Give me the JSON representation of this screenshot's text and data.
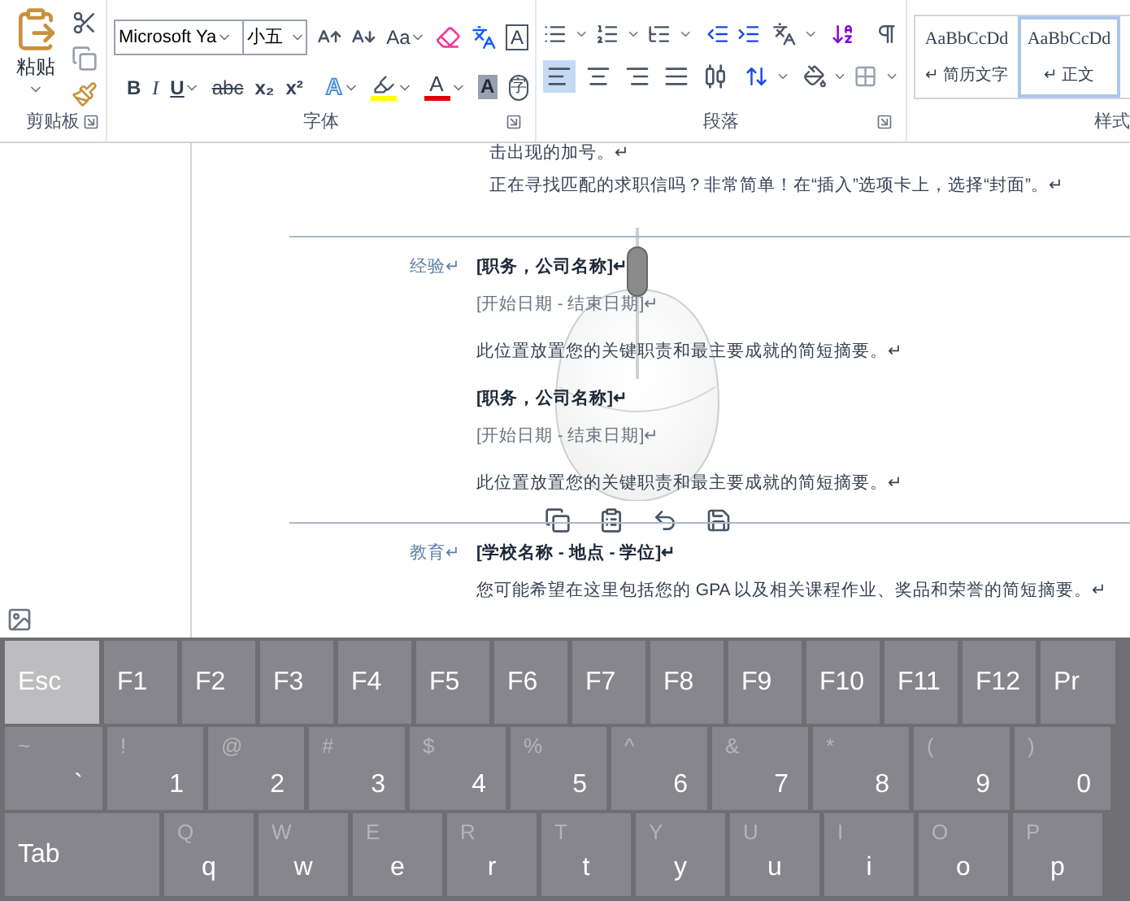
{
  "ribbon": {
    "clipboard": {
      "paste_label": "粘贴",
      "group_label": "剪贴板"
    },
    "font": {
      "font_name": "Microsoft Ya",
      "font_size": "小五",
      "change_case": "Aa",
      "boxed_char": "A",
      "group_label": "字体",
      "format_buttons": [
        "B",
        "I",
        "U",
        "abc",
        "x₂",
        "x²"
      ],
      "color_buttons": [
        {
          "kind": "effects",
          "label": "A"
        },
        {
          "kind": "highlight",
          "color": "#ffff00"
        },
        {
          "kind": "font_color",
          "label": "A",
          "color": "#e00000"
        },
        {
          "kind": "shading",
          "label": "A"
        },
        {
          "kind": "enclose",
          "label": "字"
        }
      ]
    },
    "paragraph": {
      "group_label": "段落",
      "alignments": [
        {
          "selected": true
        },
        {
          "selected": false
        },
        {
          "selected": false
        },
        {
          "selected": false
        },
        {
          "selected": false
        }
      ]
    },
    "styles": {
      "group_label": "样式",
      "items": [
        {
          "preview": "AaBbCcDd",
          "name": "↵ 简历文字",
          "selected": false
        },
        {
          "preview": "AaBbCcDd",
          "name": "↵ 正文",
          "selected": true
        }
      ]
    }
  },
  "document": {
    "intro_lines": [
      "击出现的加号。↵",
      "正在寻找匹配的求职信吗？非常简单！在“插入”选项卡上，选择“封面”。↵"
    ],
    "sections": [
      {
        "label": "经验↵",
        "entries": [
          {
            "kind": "heading",
            "text": "[职务，公司名称]↵"
          },
          {
            "kind": "date",
            "text": "[开始日期 - 结束日期]↵"
          },
          {
            "kind": "body",
            "text": "此位置放置您的关键职责和最主要成就的简短摘要。↵"
          },
          {
            "kind": "heading",
            "text": "[职务，公司名称]↵"
          },
          {
            "kind": "date",
            "text": "[开始日期 - 结束日期]↵"
          },
          {
            "kind": "body",
            "text": "此位置放置您的关键职责和最主要成就的简短摘要。↵"
          }
        ]
      },
      {
        "label": "教育↵",
        "entries": [
          {
            "kind": "heading",
            "text": "[学校名称 - 地点 - 学位]↵"
          },
          {
            "kind": "body",
            "text": "您可能希望在这里包括您的 GPA 以及相关课程作业、奖品和荣誉的简短摘要。↵"
          }
        ]
      }
    ]
  },
  "keyboard": {
    "rows": [
      {
        "kind": "function",
        "keys": [
          {
            "main": "Esc",
            "pressed": true
          },
          {
            "main": "F1",
            "pressed": false
          },
          {
            "main": "F2",
            "pressed": false
          },
          {
            "main": "F3",
            "pressed": false
          },
          {
            "main": "F4",
            "pressed": false
          },
          {
            "main": "F5",
            "pressed": false
          },
          {
            "main": "F6",
            "pressed": false
          },
          {
            "main": "F7",
            "pressed": false
          },
          {
            "main": "F8",
            "pressed": false
          },
          {
            "main": "F9",
            "pressed": false
          },
          {
            "main": "F10",
            "pressed": false
          },
          {
            "main": "F11",
            "pressed": false
          },
          {
            "main": "F12",
            "pressed": false
          },
          {
            "main": "Pr",
            "pressed": false
          }
        ]
      },
      {
        "kind": "number",
        "keys": [
          {
            "shift": "~",
            "main": "`",
            "pressed": false
          },
          {
            "shift": "!",
            "main": "1",
            "pressed": false
          },
          {
            "shift": "@",
            "main": "2",
            "pressed": false
          },
          {
            "shift": "#",
            "main": "3",
            "pressed": false
          },
          {
            "shift": "$",
            "main": "4",
            "pressed": false
          },
          {
            "shift": "%",
            "main": "5",
            "pressed": false
          },
          {
            "shift": "^",
            "main": "6",
            "pressed": false
          },
          {
            "shift": "&",
            "main": "7",
            "pressed": false
          },
          {
            "shift": "*",
            "main": "8",
            "pressed": false
          },
          {
            "shift": "(",
            "main": "9",
            "pressed": false
          },
          {
            "shift": ")",
            "main": "0",
            "pressed": false
          }
        ]
      },
      {
        "kind": "letter",
        "keys": [
          {
            "main": "Tab",
            "pressed": false
          },
          {
            "shift": "Q",
            "main": "q",
            "pressed": false
          },
          {
            "shift": "W",
            "main": "w",
            "pressed": false
          },
          {
            "shift": "E",
            "main": "e",
            "pressed": false
          },
          {
            "shift": "R",
            "main": "r",
            "pressed": false
          },
          {
            "shift": "T",
            "main": "t",
            "pressed": false
          },
          {
            "shift": "Y",
            "main": "y",
            "pressed": false
          },
          {
            "shift": "U",
            "main": "u",
            "pressed": false
          },
          {
            "shift": "I",
            "main": "i",
            "pressed": false
          },
          {
            "shift": "O",
            "main": "o",
            "pressed": false
          },
          {
            "shift": "P",
            "main": "p",
            "pressed": false
          }
        ]
      }
    ]
  }
}
